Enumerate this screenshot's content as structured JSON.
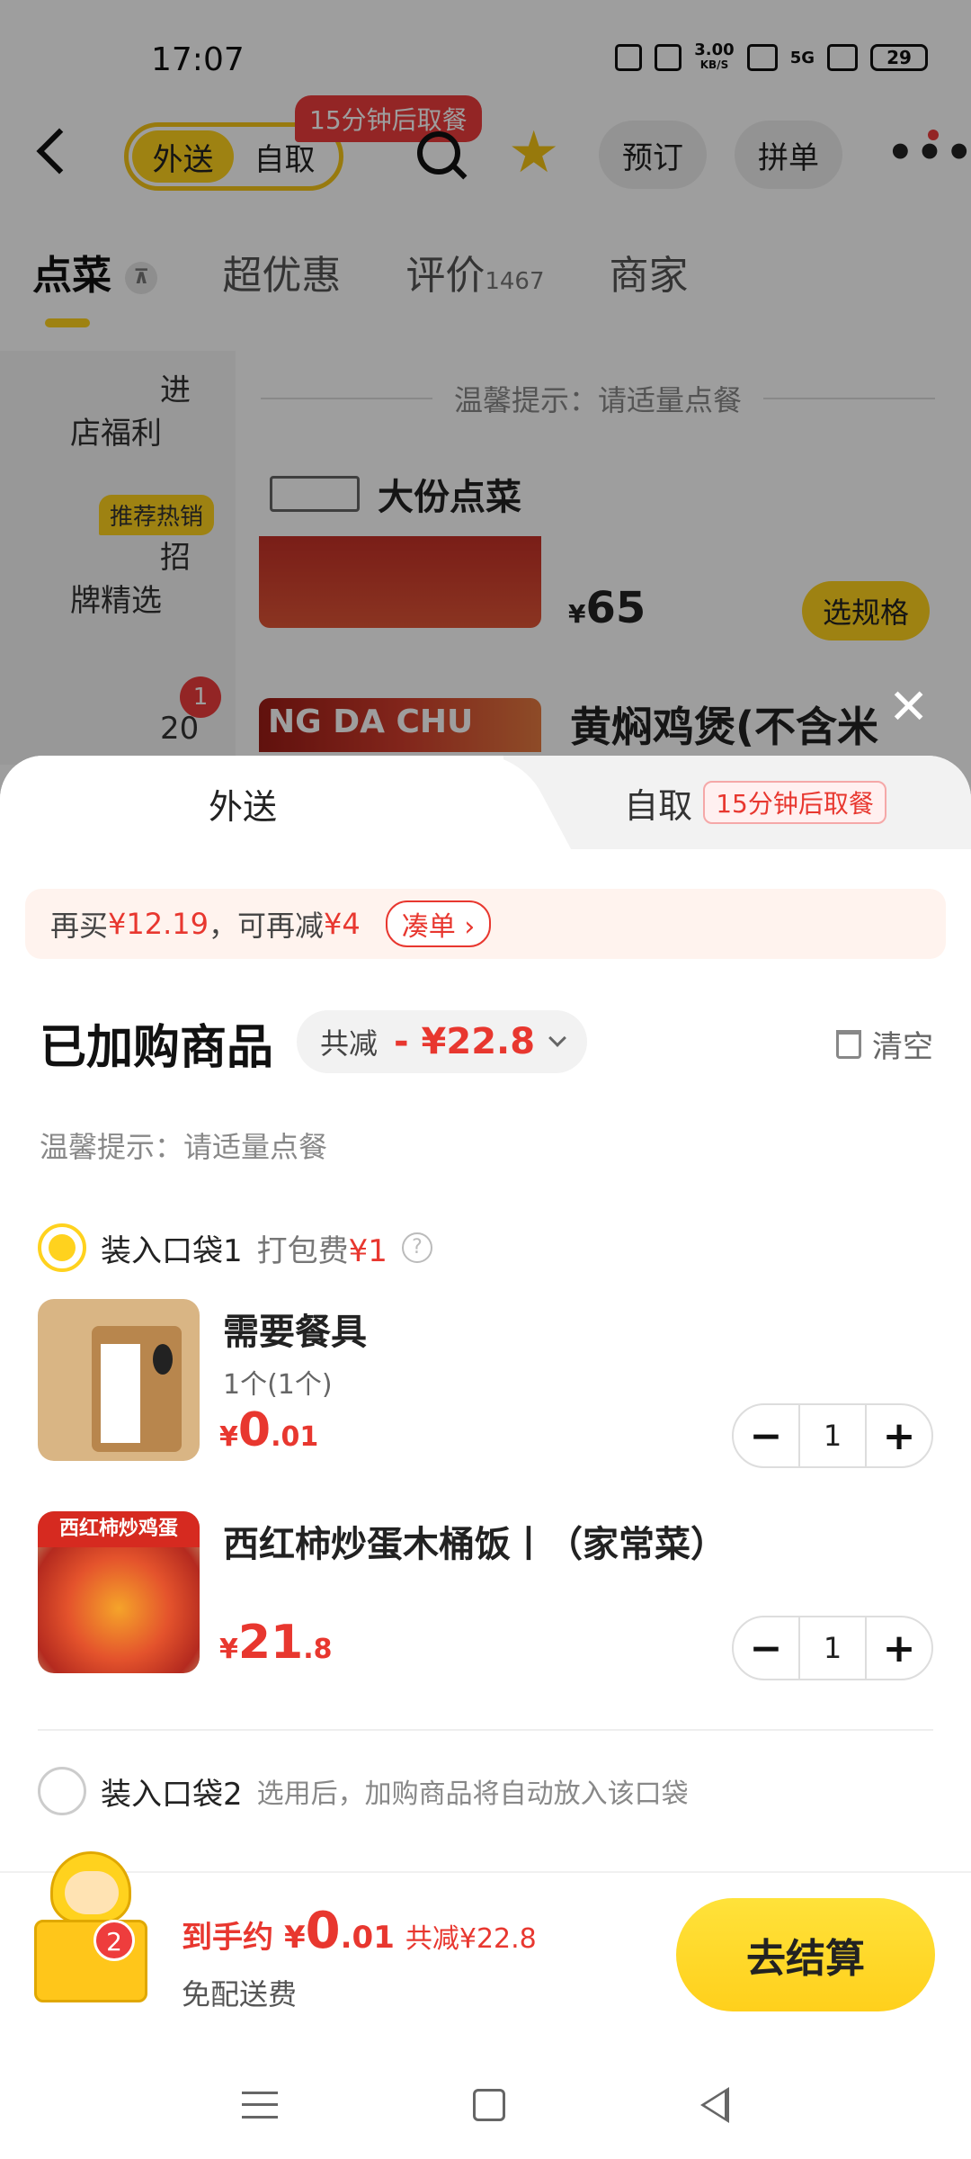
{
  "status_bar": {
    "time": "17:07",
    "net_speed": "3.00",
    "net_unit": "KB/S",
    "signal": "5G",
    "battery": "29",
    "icons": [
      "nfc-icon",
      "mute-icon",
      "wifi-icon",
      "signal-icon",
      "battery-icon"
    ]
  },
  "header": {
    "mode_delivery": "外送",
    "mode_pickup": "自取",
    "pickup_badge": "15分钟后取餐",
    "reserve_label": "预订",
    "group_label": "拼单",
    "icons": [
      "back-arrow-icon",
      "search-icon",
      "star-icon",
      "more-icon"
    ]
  },
  "tabs": [
    {
      "label": "点菜",
      "active": true
    },
    {
      "label": "超优惠"
    },
    {
      "label": "评价",
      "count": "1467"
    },
    {
      "label": "商家"
    }
  ],
  "sidebar": {
    "item1_lines": [
      "进",
      "店福利"
    ],
    "item2_tag": "推荐热销",
    "item2_lines": [
      "招",
      "牌精选"
    ],
    "item3_badge": "1",
    "item3_text": "20"
  },
  "menu": {
    "tip": "温馨提示：请适量点餐",
    "section_title": "大份点菜",
    "price_symbol": "¥",
    "price": "65",
    "spec_button": "选规格",
    "dish_title": "黄焖鸡煲(不含米",
    "img2_text": "NG DA CHU"
  },
  "sheet": {
    "tab_delivery": "外送",
    "tab_pickup": "自取",
    "pickup_tag": "15分钟后取餐",
    "promo_prefix": "再买",
    "promo_amount": "¥12.19",
    "promo_mid": "，可再减",
    "promo_discount": "¥4",
    "promo_button": "凑单",
    "title": "已加购商品",
    "discount_label": "共减",
    "discount_value": "- ¥22.8",
    "clear_label": "清空",
    "tip": "温馨提示：请适量点餐",
    "bag1_label": "装入口袋1",
    "pack_fee_label": "打包费",
    "pack_fee": "¥1",
    "bag2_label": "装入口袋2",
    "bag2_hint": "选用后，加购商品将自动放入该口袋",
    "items": [
      {
        "name": "需要餐具",
        "sub": "1个(1个)",
        "price_symbol": "¥",
        "price_int": "0",
        "price_dec": ".01",
        "qty": "1"
      },
      {
        "name": "西红柿炒蛋木桶饭丨（家常菜）",
        "sub": "",
        "price_symbol": "¥",
        "price_int": "21",
        "price_dec": ".8",
        "qty": "1",
        "img_banner": "西红柿炒鸡蛋"
      }
    ]
  },
  "footer": {
    "cart_count": "2",
    "total_label": "到手约",
    "total_symbol": "¥",
    "total_int": "0",
    "total_dec": ".01",
    "total_saved": "共减¥22.8",
    "free_delivery": "免配送费",
    "checkout_label": "去结算"
  },
  "colors": {
    "brand_yellow": "#ffd21e",
    "accent_red": "#e8372f",
    "overlay": "rgba(0,0,0,0.38)"
  }
}
